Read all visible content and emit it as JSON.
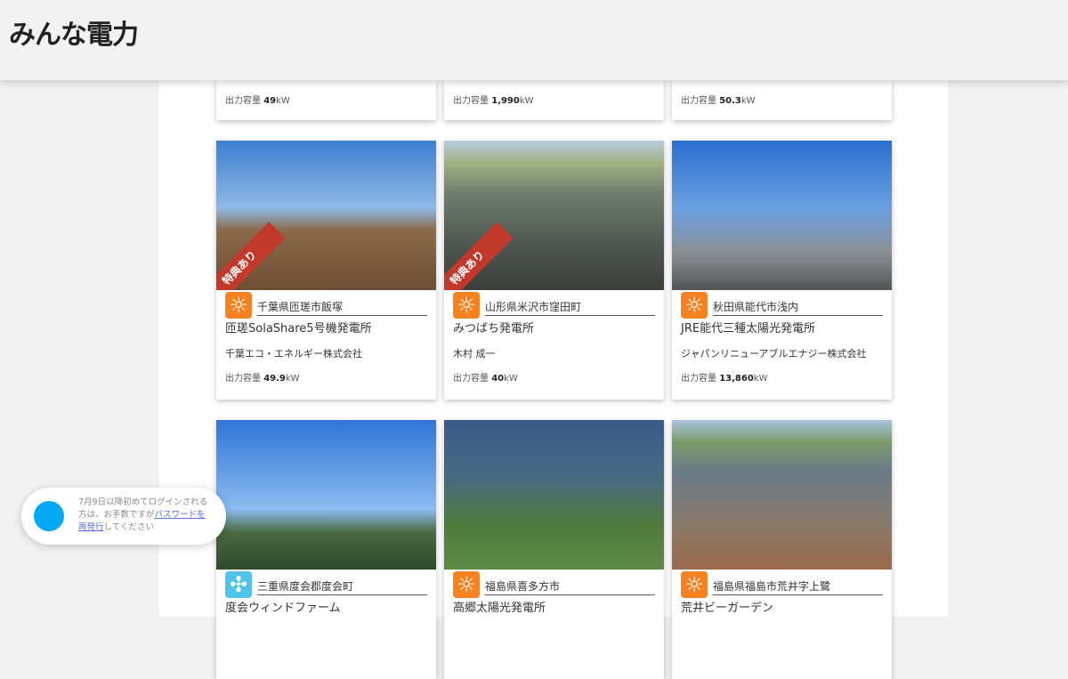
{
  "header": {
    "logo": "みんな電力"
  },
  "top_row": [
    {
      "capacity_label": "出力容量",
      "capacity_value": "49",
      "unit": "kW"
    },
    {
      "capacity_label": "出力容量",
      "capacity_value": "1,990",
      "unit": "kW"
    },
    {
      "capacity_label": "出力容量",
      "capacity_value": "50.3",
      "unit": "kW"
    }
  ],
  "cards": [
    {
      "badge": "特典あり",
      "location": "千葉県匝瑳市飯塚",
      "name": "匝瑳SolaShare5号機発電所",
      "owner": "千葉エコ・エネルギー株式会社",
      "capacity_label": "出力容量",
      "capacity_value": "49.9",
      "unit": "kW",
      "icon": "sun-icon"
    },
    {
      "badge": "特典あり",
      "location": "山形県米沢市窪田町",
      "name": "みつばち発電所",
      "owner": "木村 成一",
      "capacity_label": "出力容量",
      "capacity_value": "40",
      "unit": "kW",
      "icon": "sun-icon"
    },
    {
      "location": "秋田県能代市浅内",
      "name": "JRE能代三種太陽光発電所",
      "owner": "ジャパンリニューアブルエナジー株式会社",
      "capacity_label": "出力容量",
      "capacity_value": "13,860",
      "unit": "kW",
      "icon": "sun-icon"
    },
    {
      "location": "三重県度会郡度会町",
      "name": "度会ウィンドファーム",
      "icon": "wind-icon"
    },
    {
      "location": "福島県喜多方市",
      "name": "高郷太陽光発電所",
      "icon": "sun-icon"
    },
    {
      "location": "福島県福島市荒井字上鷺",
      "name": "荒井ビーガーデン",
      "icon": "sun-icon"
    }
  ],
  "toast": {
    "text1": "7月9日以降初めてログインされる方は、お手数ですが",
    "link": "パスワードを再発行",
    "text2": "してください"
  }
}
